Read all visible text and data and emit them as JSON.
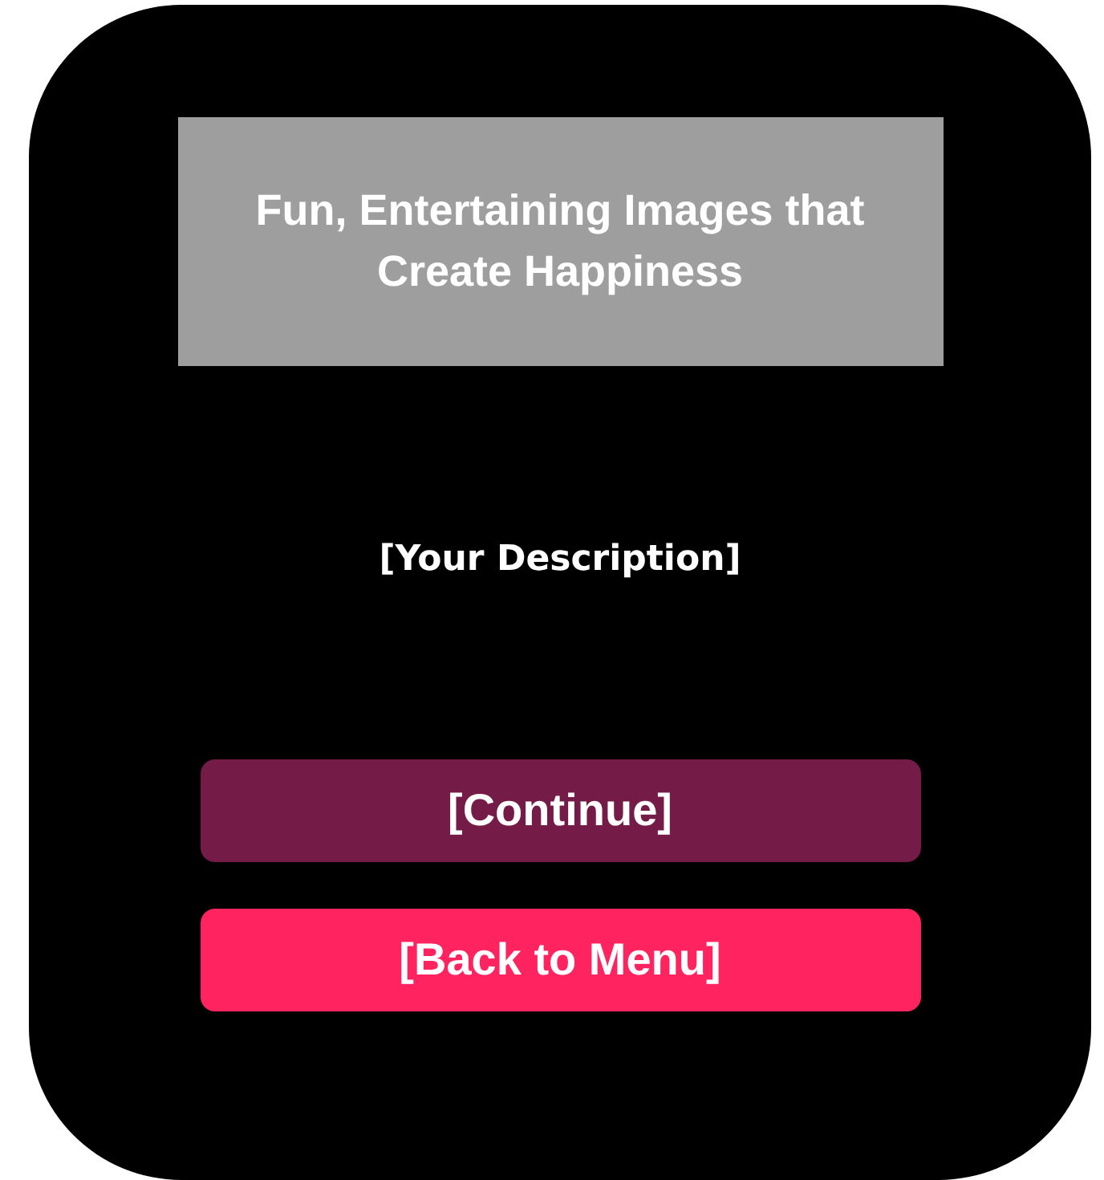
{
  "header": {
    "title": "Fun, Entertaining Images that Create Happiness"
  },
  "description": "[Your Description]",
  "buttons": [
    {
      "label": "[Continue]",
      "kind": "primary"
    },
    {
      "label": "[Back to Menu]",
      "kind": "secondary"
    }
  ]
}
